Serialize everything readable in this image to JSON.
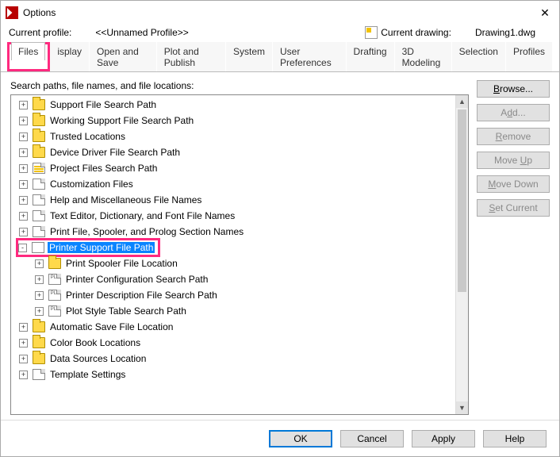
{
  "window": {
    "title": "Options"
  },
  "profile": {
    "label": "Current profile:",
    "value": "<<Unnamed Profile>>",
    "drawing_label": "Current drawing:",
    "drawing_value": "Drawing1.dwg"
  },
  "tabs": {
    "files": "Files",
    "display_trunc": "isplay",
    "open_save": "Open and Save",
    "plot_publish": "Plot and Publish",
    "system": "System",
    "user_prefs": "User Preferences",
    "drafting": "Drafting",
    "modeling": "3D Modeling",
    "selection": "Selection",
    "profiles": "Profiles"
  },
  "tree_label": "Search paths, file names, and file locations:",
  "tree": {
    "items": [
      {
        "label": "Support File Search Path",
        "icon": "folder-stack",
        "exp": "+",
        "indent": 0
      },
      {
        "label": "Working Support File Search Path",
        "icon": "folder-stack",
        "exp": "+",
        "indent": 0
      },
      {
        "label": "Trusted Locations",
        "icon": "folder-stack",
        "exp": "+",
        "indent": 0
      },
      {
        "label": "Device Driver File Search Path",
        "icon": "folder-stack",
        "exp": "+",
        "indent": 0
      },
      {
        "label": "Project Files Search Path",
        "icon": "doc-y",
        "exp": "+",
        "indent": 0
      },
      {
        "label": "Customization Files",
        "icon": "doc",
        "exp": "+",
        "indent": 0
      },
      {
        "label": "Help and Miscellaneous File Names",
        "icon": "doc",
        "exp": "+",
        "indent": 0
      },
      {
        "label": "Text Editor, Dictionary, and Font File Names",
        "icon": "doc",
        "exp": "+",
        "indent": 0
      },
      {
        "label": "Print File, Spooler, and Prolog Section Names",
        "icon": "doc",
        "exp": "+",
        "indent": 0
      },
      {
        "label": "Printer Support File Path",
        "icon": "docstack",
        "exp": "-",
        "indent": 0,
        "selected": true,
        "highlighted": true
      },
      {
        "label": "Print Spooler File Location",
        "icon": "folder",
        "exp": "+",
        "indent": 1
      },
      {
        "label": "Printer Configuration Search Path",
        "icon": "doc-plt",
        "exp": "+",
        "indent": 1
      },
      {
        "label": "Printer Description File Search Path",
        "icon": "doc-plt",
        "exp": "+",
        "indent": 1
      },
      {
        "label": "Plot Style Table Search Path",
        "icon": "doc-plt",
        "exp": "+",
        "indent": 1
      },
      {
        "label": "Automatic Save File Location",
        "icon": "folder-stack",
        "exp": "+",
        "indent": 0
      },
      {
        "label": "Color Book Locations",
        "icon": "folder-stack",
        "exp": "+",
        "indent": 0
      },
      {
        "label": "Data Sources Location",
        "icon": "folder-stack",
        "exp": "+",
        "indent": 0
      },
      {
        "label": "Template Settings",
        "icon": "doc",
        "exp": "+",
        "indent": 0
      }
    ]
  },
  "buttons": {
    "browse": "Browse...",
    "add": "Add...",
    "remove": "Remove",
    "move_up": "Move Up",
    "move_down": "Move Down",
    "set_current": "Set Current"
  },
  "footer": {
    "ok": "OK",
    "cancel": "Cancel",
    "apply": "Apply",
    "help": "Help"
  }
}
